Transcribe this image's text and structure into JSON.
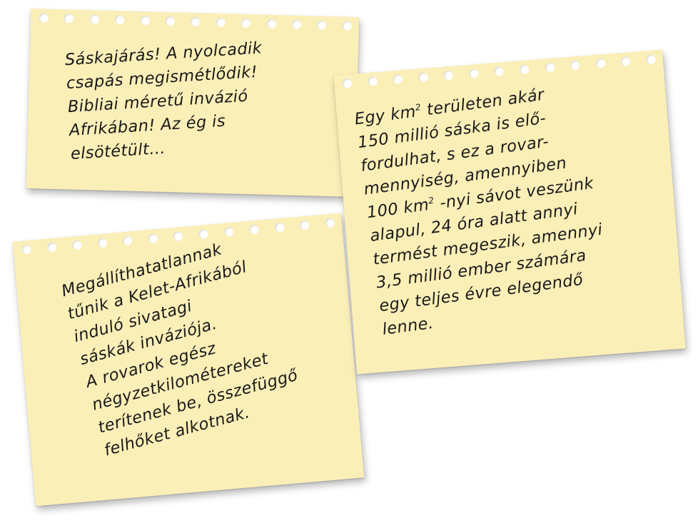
{
  "notes": {
    "note1": {
      "text": "Sáskajárás! A nyolcadik\ncsapás megismétlődik!\nBibliai méretű invázió\nAfrikában! Az ég is\nelsötétült..."
    },
    "note2": {
      "line1": "Egy km",
      "sup1": "2",
      "line1_rest": " területen akár",
      "middle": "\n150 millió sáska is elő-\nfordulhat, s ez a rovar-\nmennyiség, amennyiben\n100 km",
      "sup2": "2",
      "rest": " -nyi sávot veszünk\nalapul, 24 óra alatt annyi\ntermést megeszik, amennyi\n3,5 millió ember számára\negy teljes évre elegendő\nlenne."
    },
    "note3": {
      "text": "Megállíthatatlannak\ntűnik a Kelet-Afrikából\ninduló sivatagi\nsáskák inváziója.\nA rovarok egész\nnégyzetkilométereket\nterítenek be, összefüggő\nfelhőket alkotnak."
    }
  },
  "colors": {
    "paper": "#fbefb8",
    "ink": "#1a1a1a"
  }
}
